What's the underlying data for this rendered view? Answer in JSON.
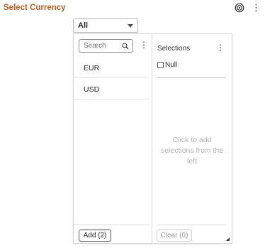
{
  "header": {
    "title": "Select Currency",
    "icons": {
      "target": "target-icon",
      "menu": "kebab-menu-icon"
    }
  },
  "dropdown": {
    "selected": "All"
  },
  "left_panel": {
    "search_placeholder": "Search",
    "items": [
      {
        "label": "EUR"
      },
      {
        "label": "USD"
      }
    ],
    "add_button": "Add (2)"
  },
  "right_panel": {
    "title": "Selections",
    "null_option": "Null",
    "null_checked": false,
    "empty_message": "Click to add selections from the left",
    "clear_button": "Clear (0)"
  },
  "colors": {
    "title": "#b85c1e",
    "disabled_text": "#b3b3b3"
  }
}
